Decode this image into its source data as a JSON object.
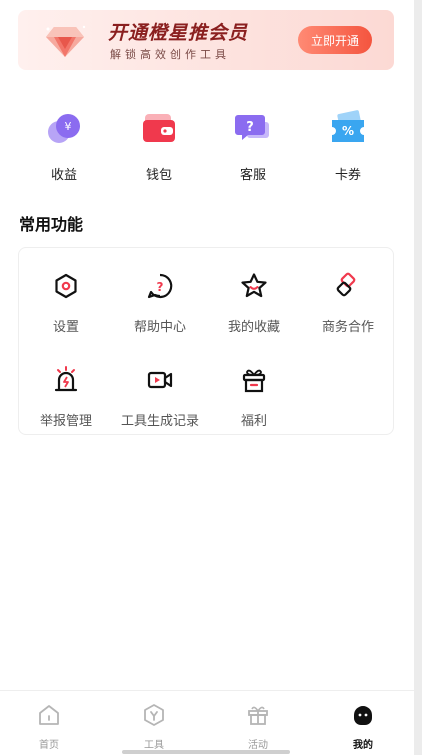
{
  "vip_banner": {
    "title": "开通橙星推会员",
    "subtitle": "解锁高效创作工具",
    "button_label": "立即开通"
  },
  "quick_actions": [
    {
      "label": "收益",
      "icon": "coin-icon"
    },
    {
      "label": "钱包",
      "icon": "wallet-icon"
    },
    {
      "label": "客服",
      "icon": "customer-service-icon"
    },
    {
      "label": "卡券",
      "icon": "coupon-icon"
    }
  ],
  "common_functions": {
    "title": "常用功能",
    "items": [
      {
        "label": "设置",
        "icon": "settings-icon"
      },
      {
        "label": "帮助中心",
        "icon": "help-icon"
      },
      {
        "label": "我的收藏",
        "icon": "star-icon"
      },
      {
        "label": "商务合作",
        "icon": "cooperation-icon"
      },
      {
        "label": "举报管理",
        "icon": "alarm-icon"
      },
      {
        "label": "工具生成记录",
        "icon": "video-record-icon"
      },
      {
        "label": "福利",
        "icon": "gift-icon"
      }
    ]
  },
  "bottom_nav": {
    "items": [
      {
        "label": "首页",
        "icon": "home-icon",
        "active": false
      },
      {
        "label": "工具",
        "icon": "tools-icon",
        "active": false
      },
      {
        "label": "活动",
        "icon": "activity-gift-icon",
        "active": false
      },
      {
        "label": "我的",
        "icon": "profile-icon",
        "active": true
      }
    ]
  },
  "colors": {
    "accent": "#f4553f",
    "icon_purple": "#8b6cf0",
    "icon_red": "#f0394d",
    "icon_blue": "#3aa6f0",
    "text_primary": "#222222",
    "text_secondary": "#555555"
  }
}
